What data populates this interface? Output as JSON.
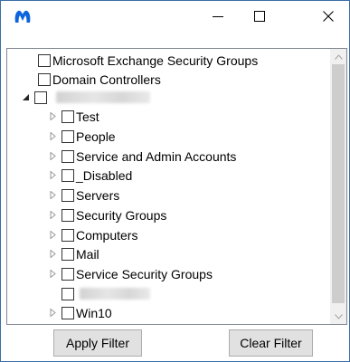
{
  "window": {
    "controls": {
      "minimize_glyph": "—",
      "maximize_glyph": "☐",
      "close_glyph": "✕"
    },
    "app_icon": "malwarebytes-logo-icon",
    "accent_color": "#0e64dc"
  },
  "tree": {
    "nodes": [
      {
        "label": "Microsoft Exchange Security Groups",
        "expander": "none",
        "checked": false
      },
      {
        "label": "Domain Controllers",
        "expander": "none",
        "checked": false
      },
      {
        "label": "",
        "expander": "expanded",
        "checked": false,
        "redacted": true
      },
      {
        "label": "Test",
        "expander": "collapsed",
        "checked": false
      },
      {
        "label": "People",
        "expander": "collapsed",
        "checked": false
      },
      {
        "label": "Service and Admin Accounts",
        "expander": "collapsed",
        "checked": false
      },
      {
        "label": "_Disabled",
        "expander": "collapsed",
        "checked": false
      },
      {
        "label": "Servers",
        "expander": "collapsed",
        "checked": false
      },
      {
        "label": "Security Groups",
        "expander": "collapsed",
        "checked": false
      },
      {
        "label": "Computers",
        "expander": "collapsed",
        "checked": false
      },
      {
        "label": "Mail",
        "expander": "collapsed",
        "checked": false
      },
      {
        "label": "Service Security Groups",
        "expander": "collapsed",
        "checked": false
      },
      {
        "label": "",
        "expander": "none",
        "checked": false,
        "redacted": true
      },
      {
        "label": "Win10",
        "expander": "collapsed",
        "checked": false
      }
    ]
  },
  "footer": {
    "apply_label": "Apply Filter",
    "clear_label": "Clear Filter"
  }
}
